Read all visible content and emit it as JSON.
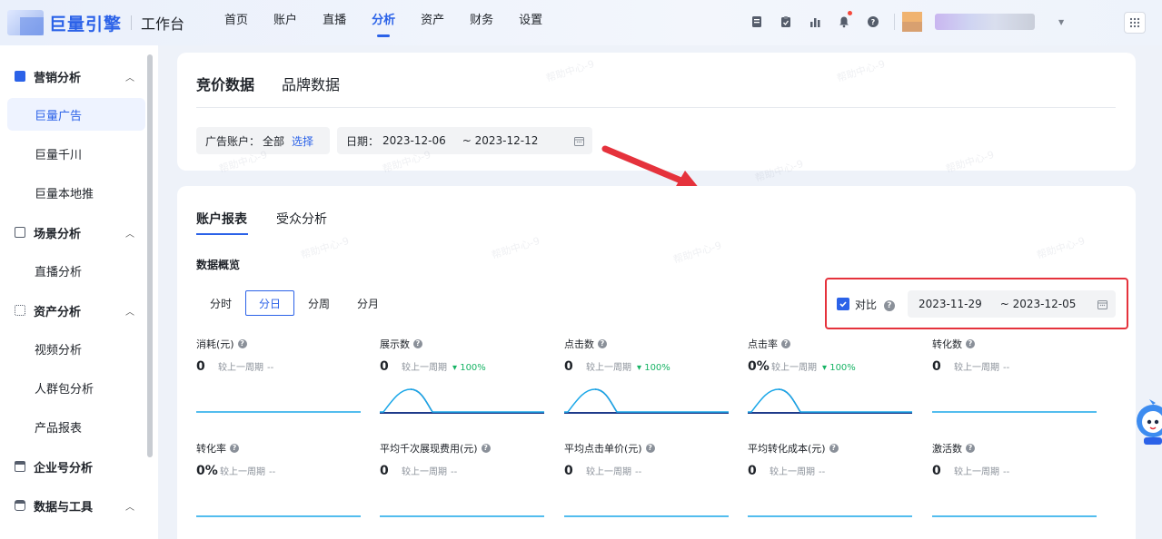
{
  "topbar": {
    "brand": "巨量引擎",
    "workbench": "工作台",
    "nav": [
      {
        "label": "首页",
        "active": false
      },
      {
        "label": "账户",
        "active": false
      },
      {
        "label": "直播",
        "active": false
      },
      {
        "label": "分析",
        "active": true
      },
      {
        "label": "资产",
        "active": false
      },
      {
        "label": "财务",
        "active": false
      },
      {
        "label": "设置",
        "active": false
      }
    ],
    "icons": [
      "document-icon",
      "clipboard-icon",
      "chart-icon",
      "bell-icon",
      "help-icon"
    ],
    "accent": "#2b62e8"
  },
  "sidebar": {
    "sections": [
      {
        "label": "营销分析",
        "icon": "marketing-icon",
        "expanded": true
      },
      {
        "label": "场景分析",
        "icon": "scene-icon",
        "expanded": true
      },
      {
        "label": "资产分析",
        "icon": "asset-icon",
        "expanded": true
      },
      {
        "label": "企业号分析",
        "icon": "enterprise-icon",
        "expanded": false
      },
      {
        "label": "数据与工具",
        "icon": "tools-icon",
        "expanded": true
      }
    ],
    "items": [
      {
        "label": "巨量广告",
        "active": true
      },
      {
        "label": "巨量千川",
        "active": false
      },
      {
        "label": "巨量本地推",
        "active": false
      },
      {
        "label": "直播分析",
        "active": false
      },
      {
        "label": "视频分析",
        "active": false
      },
      {
        "label": "人群包分析",
        "active": false
      },
      {
        "label": "产品报表",
        "active": false
      }
    ]
  },
  "header_card": {
    "tabs": [
      {
        "label": "竞价数据",
        "active": true
      },
      {
        "label": "品牌数据",
        "active": false
      }
    ],
    "account_filter": {
      "label": "广告账户：",
      "value": "全部",
      "link": "选择"
    },
    "date_filter": {
      "label": "日期：",
      "start": "2023-12-06",
      "end": "~ 2023-12-12"
    }
  },
  "report_card": {
    "tabs": [
      {
        "label": "账户报表",
        "active": true
      },
      {
        "label": "受众分析",
        "active": false
      }
    ],
    "section_title": "数据概览",
    "granularity": [
      {
        "label": "分时",
        "active": false
      },
      {
        "label": "分日",
        "active": true
      },
      {
        "label": "分周",
        "active": false
      },
      {
        "label": "分月",
        "active": false
      }
    ],
    "compare": {
      "checked": true,
      "label": "对比",
      "start": "2023-11-29",
      "end": "~ 2023-12-05"
    },
    "metrics": [
      {
        "label": "消耗(元)",
        "value": "0",
        "cmp": "较上一周期",
        "delta": "--",
        "up": false
      },
      {
        "label": "展示数",
        "value": "0",
        "cmp": "较上一周期",
        "delta": "100%",
        "up": true
      },
      {
        "label": "点击数",
        "value": "0",
        "cmp": "较上一周期",
        "delta": "100%",
        "up": true
      },
      {
        "label": "点击率",
        "value": "0%",
        "cmp": "较上一周期",
        "delta": "100%",
        "up": true
      },
      {
        "label": "转化数",
        "value": "0",
        "cmp": "较上一周期",
        "delta": "--",
        "up": false
      },
      {
        "label": "转化率",
        "value": "0%",
        "cmp": "较上一周期",
        "delta": "--",
        "up": false
      },
      {
        "label": "平均千次展现费用(元)",
        "value": "0",
        "cmp": "较上一周期",
        "delta": "--",
        "up": false
      },
      {
        "label": "平均点击单价(元)",
        "value": "0",
        "cmp": "较上一周期",
        "delta": "--",
        "up": false
      },
      {
        "label": "平均转化成本(元)",
        "value": "0",
        "cmp": "较上一周期",
        "delta": "--",
        "up": false
      },
      {
        "label": "激活数",
        "value": "0",
        "cmp": "较上一周期",
        "delta": "--",
        "up": false
      }
    ],
    "colors": {
      "spark_current": "#1aa7e8",
      "spark_previous": "#1f3b8a",
      "up": "#16b364",
      "highlight": "#e5323c"
    }
  },
  "watermark": "帮助中心-9"
}
